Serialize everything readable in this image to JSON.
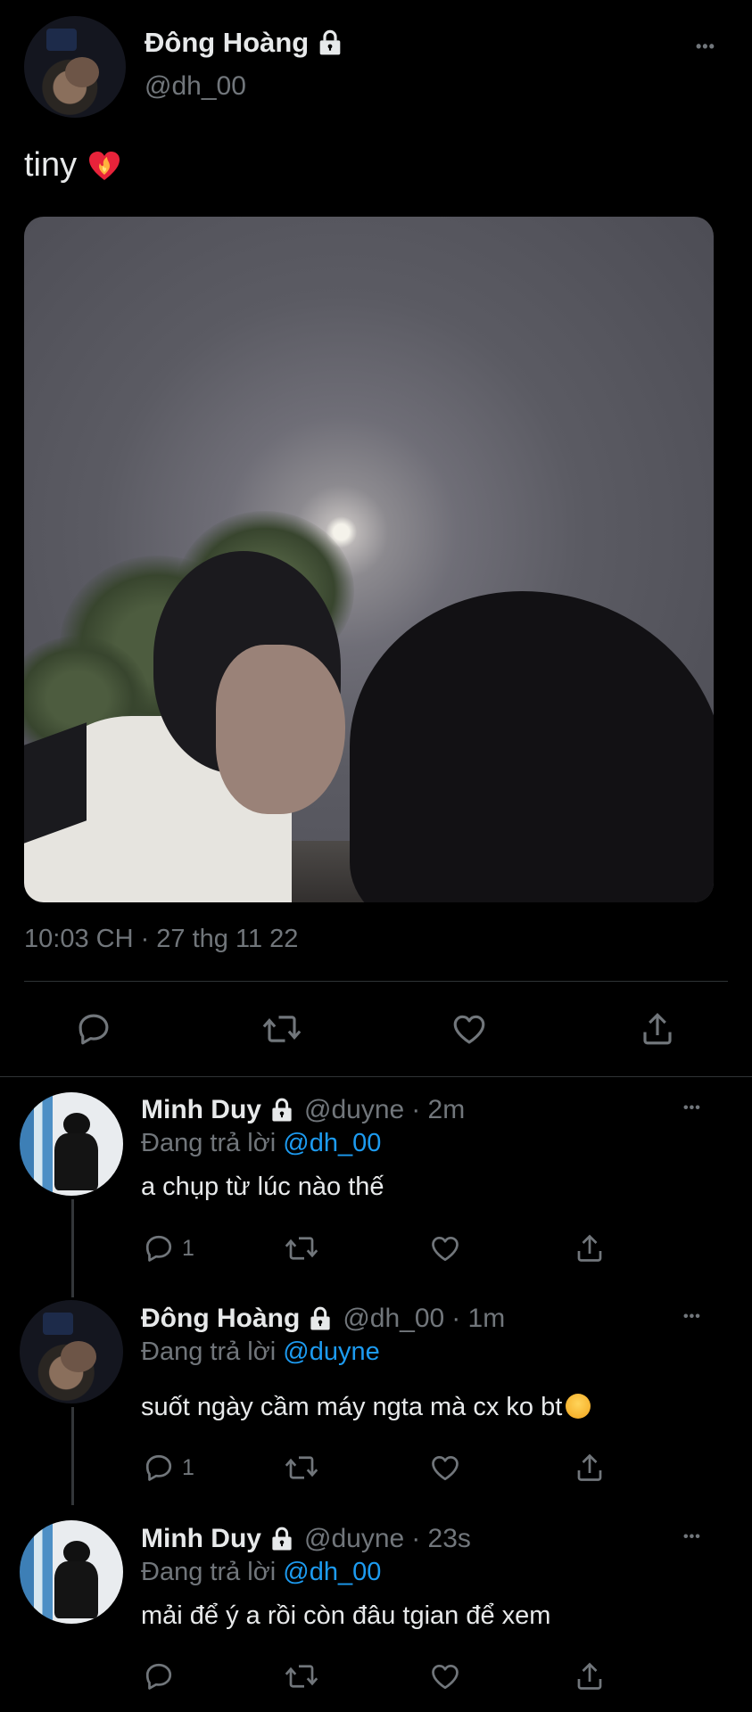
{
  "main_tweet": {
    "display_name": "Đông Hoàng",
    "handle": "@dh_00",
    "text": "tiny",
    "emoji": "❤️‍🔥",
    "timestamp": "10:03 CH · 27 thg 11 22",
    "more": "•••"
  },
  "replies": [
    {
      "display_name": "Minh Duy",
      "handle": "@duyne",
      "time": "· 2m",
      "replying_prefix": "Đang trả lời",
      "replying_to": "@dh_00",
      "text": "a chụp từ lúc nào thế",
      "reply_count": "1",
      "more": "•••"
    },
    {
      "display_name": "Đông Hoàng",
      "handle": "@dh_00",
      "time": "· 1m",
      "replying_prefix": "Đang trả lời",
      "replying_to": "@duyne",
      "text": "suốt ngày cầm máy ngta mà cx ko bt",
      "emoji": "😤",
      "reply_count": "1",
      "more": "•••"
    },
    {
      "display_name": "Minh Duy",
      "handle": "@duyne",
      "time": "· 23s",
      "replying_prefix": "Đang trả lời",
      "replying_to": "@dh_00",
      "text": "mải để ý a rồi còn đâu tgian để xem",
      "reply_count": "",
      "more": "•••"
    }
  ],
  "colors": {
    "background": "#000000",
    "text": "#e7e9ea",
    "secondary": "#71767b",
    "link": "#1d9bf0",
    "divider": "#2f3336"
  },
  "icons": [
    "lock-icon",
    "reply-icon",
    "retweet-icon",
    "like-icon",
    "share-icon",
    "more-icon"
  ]
}
